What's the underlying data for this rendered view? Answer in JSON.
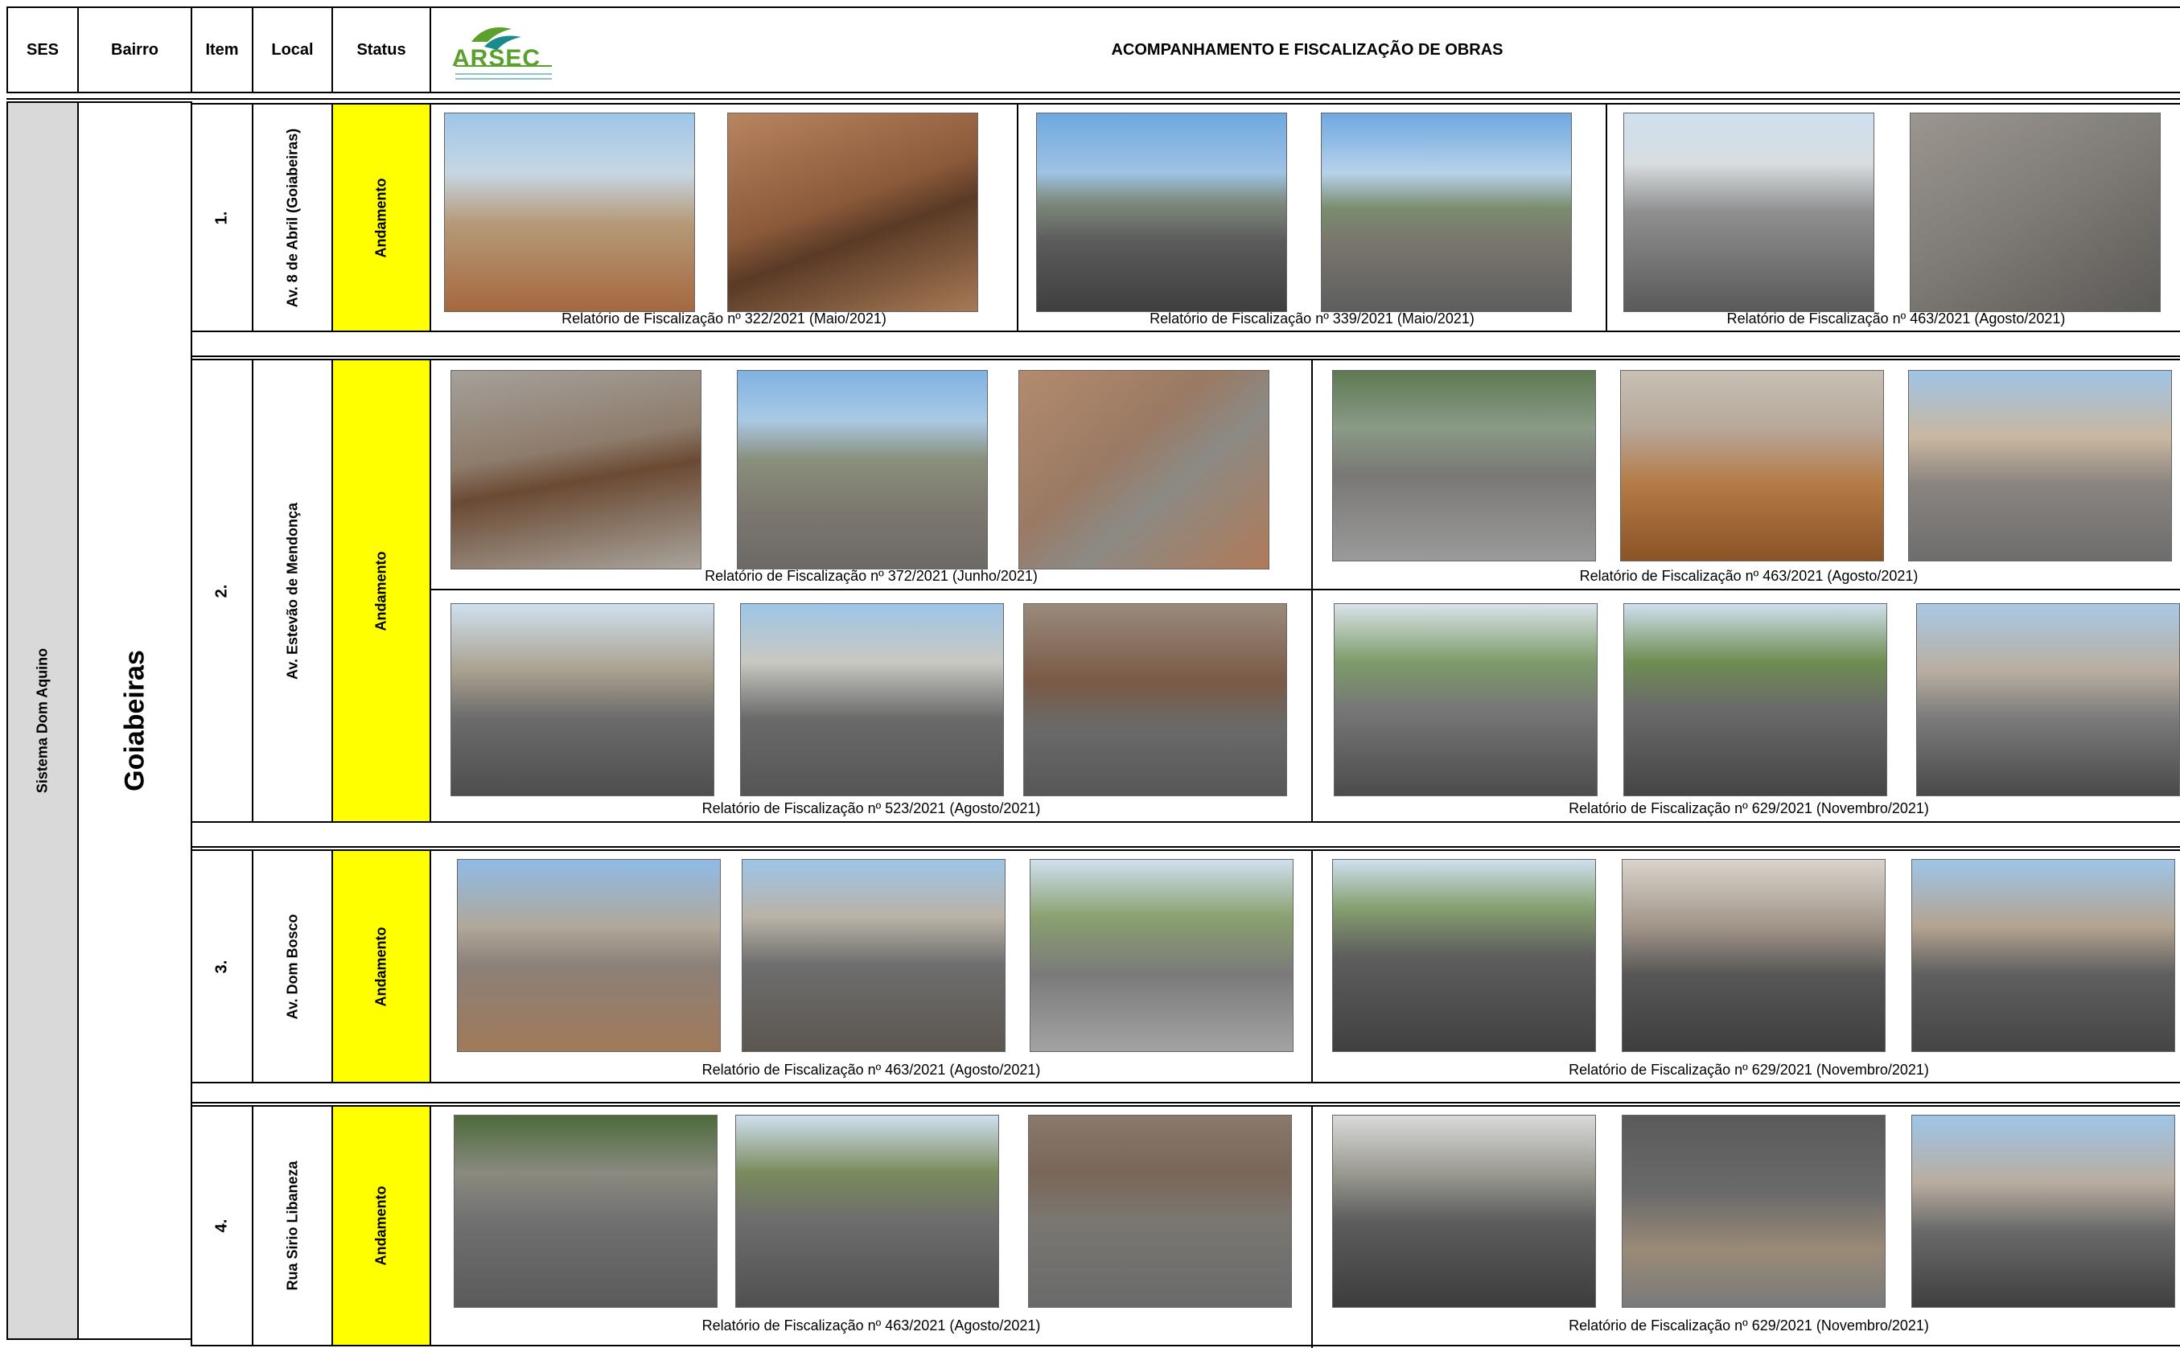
{
  "header": {
    "col_ses": "SES",
    "col_bairro": "Bairro",
    "col_item": "Item",
    "col_local": "Local",
    "col_status": "Status",
    "logo_text": "ARSEC",
    "title": "ACOMPANHAMENTO E FISCALIZAÇÃO DE OBRAS"
  },
  "ses": "Sistema Dom Aquino",
  "bairro": "Goiabeiras",
  "rows": [
    {
      "item": "1.",
      "local": "Av. 8 de Abril (Goiabeiras)",
      "status": "Andamento",
      "captions": [
        "Relatório de Fiscalização nº 322/2021 (Maio/2021)",
        "Relatório de Fiscalização nº 339/2021 (Maio/2021)",
        "Relatório de Fiscalização nº 463/2021 (Agosto/2021)"
      ]
    },
    {
      "item": "2.",
      "local": "Av. Estevão de Mendonça",
      "status": "Andamento",
      "captions": [
        "Relatório de Fiscalização nº 372/2021 (Junho/2021)",
        "Relatório de Fiscalização nº 463/2021 (Agosto/2021)",
        "Relatório de Fiscalização nº 523/2021 (Agosto/2021)",
        "Relatório de Fiscalização nº 629/2021 (Novembro/2021)"
      ]
    },
    {
      "item": "3.",
      "local": "Av. Dom Bosco",
      "status": "Andamento",
      "captions": [
        "Relatório de Fiscalização nº 463/2021 (Agosto/2021)",
        "Relatório de Fiscalização nº 629/2021 (Novembro/2021)"
      ]
    },
    {
      "item": "4.",
      "local": "Rua Sirio Libaneza",
      "status": "Andamento",
      "captions": [
        "Relatório de Fiscalização nº 463/2021 (Agosto/2021)",
        "Relatório de Fiscalização nº 629/2021 (Novembro/2021)"
      ]
    }
  ],
  "colors": {
    "status_bg": "#ffff00",
    "ses_bg": "#d9d9d9",
    "logo_green": "#5aa02c",
    "logo_teal": "#1b8a8f"
  }
}
